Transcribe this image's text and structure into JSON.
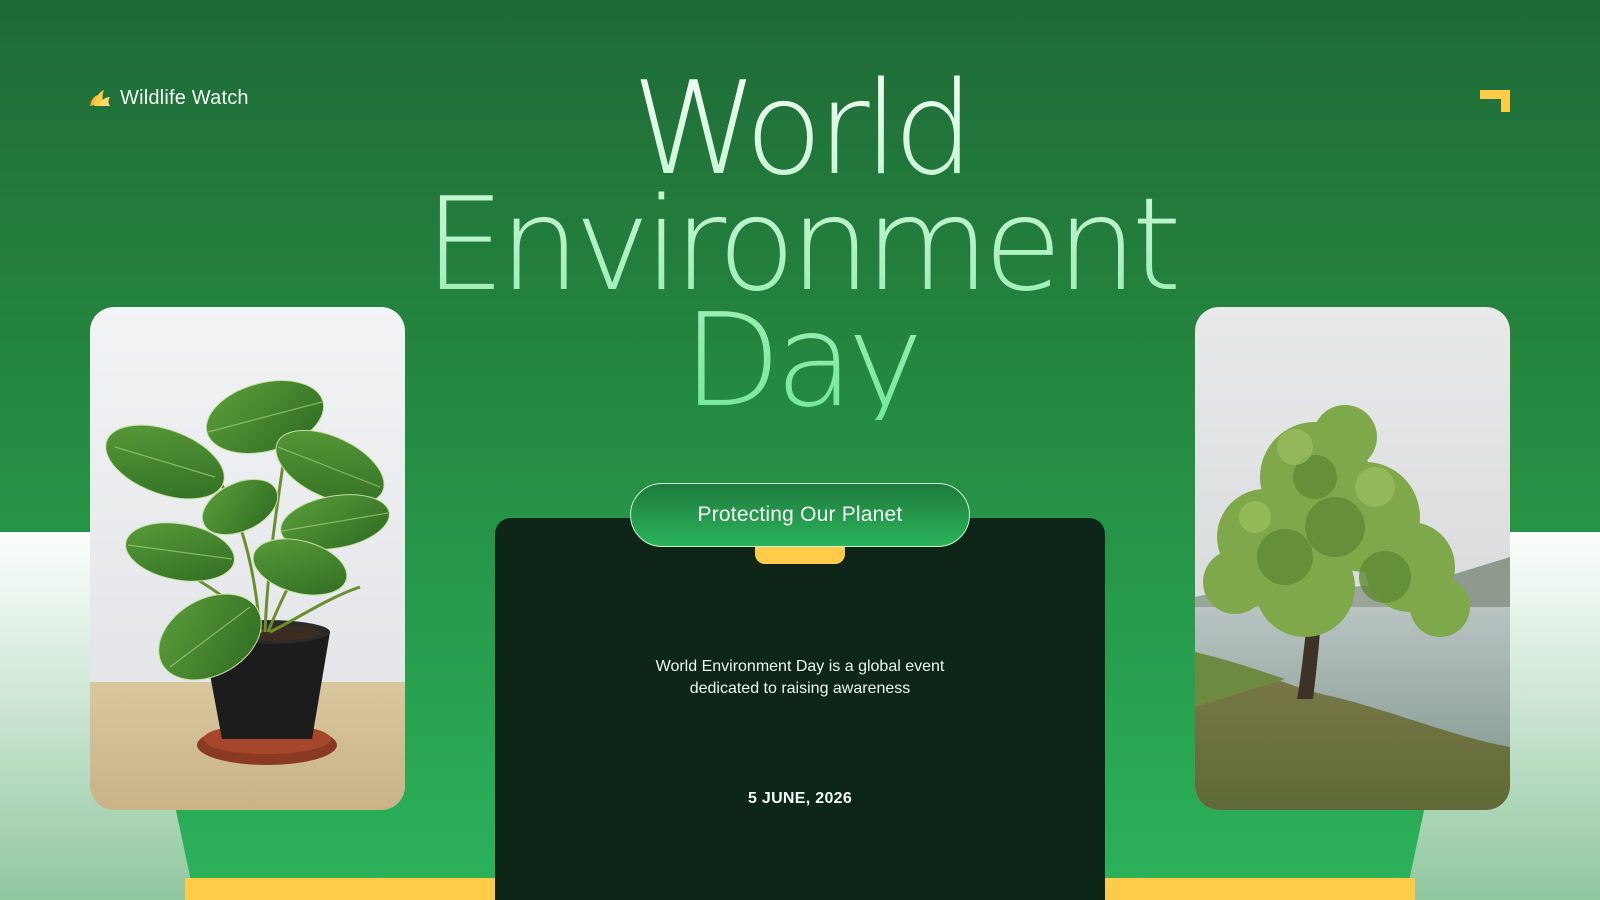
{
  "brand": {
    "name": "Wildlife Watch",
    "icon": "leaf-icon"
  },
  "title": {
    "line1": "World",
    "line2": "Environment",
    "line3": "Day"
  },
  "pill": {
    "label": "Protecting Our Planet"
  },
  "description": {
    "line1": "World Environment Day is a global event",
    "line2": "dedicated to raising awareness"
  },
  "date": "5 JUNE, 2026",
  "colors": {
    "accent_yellow": "#ffcc4a",
    "dark_panel": "#0d2617",
    "green_bg": "#24863f",
    "light_green": "#74e79a"
  },
  "images": {
    "left": "potted-plant-photo",
    "right": "tree-by-lake-photo"
  }
}
